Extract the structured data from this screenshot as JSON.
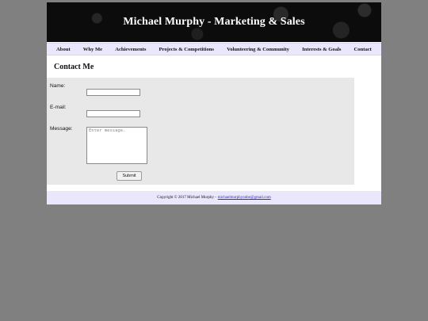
{
  "banner": {
    "title": "Michael Murphy - Marketing & Sales"
  },
  "nav": {
    "items": [
      {
        "label": "About"
      },
      {
        "label": "Why Me"
      },
      {
        "label": "Achievements"
      },
      {
        "label": "Projects & Competitions"
      },
      {
        "label": "Volunteering & Community"
      },
      {
        "label": "Interests & Goals"
      },
      {
        "label": "Contact"
      }
    ]
  },
  "main": {
    "heading": "Contact Me"
  },
  "form": {
    "name_label": "Name:",
    "name_value": "",
    "email_label": "E-mail:",
    "email_value": "",
    "message_label": "Message:",
    "message_placeholder": "Enter message.",
    "submit_label": "Submit"
  },
  "footer": {
    "copyright": "Copyright © 2017 Michael Murphy -",
    "email_link": "michaelmurphyonbe@gmail.com"
  },
  "colors": {
    "page_background": "#808080",
    "banner_background": "#0c0c0c",
    "nav_background": "#eae6fb",
    "form_panel": "#e8e8e8",
    "link": "#2a2ad0"
  }
}
